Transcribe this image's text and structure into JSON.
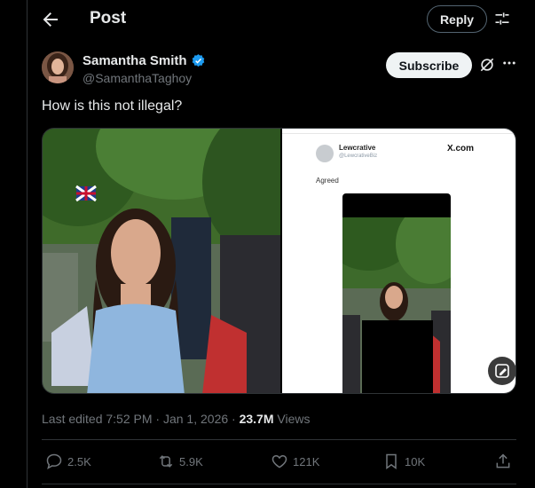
{
  "header": {
    "title": "Post",
    "reply_label": "Reply",
    "back_icon": "arrow-left-icon",
    "settings_icon": "sliders-icon"
  },
  "author": {
    "name": "Samantha Smith",
    "handle": "@SamanthaTaghoy",
    "verified": true,
    "subscribe_label": "Subscribe"
  },
  "post": {
    "text": "How is this not illegal?",
    "embedded_screenshot": {
      "author_name": "Lewcrative",
      "author_handle": "@LewcrativeBiz",
      "watermark": "X.com",
      "reply_text": "Agreed"
    }
  },
  "meta": {
    "edited_prefix": "Last edited 7:52 PM · Jan 1, 2026 · ",
    "views_count": "23.7M",
    "views_label": " Views"
  },
  "actions": {
    "replies": "2.5K",
    "reposts": "5.9K",
    "likes": "121K",
    "bookmarks": "10K"
  },
  "colors": {
    "background": "#000000",
    "text": "#e7e9ea",
    "muted": "#71767b",
    "border": "#2f3336",
    "verified": "#1d9bf0"
  }
}
